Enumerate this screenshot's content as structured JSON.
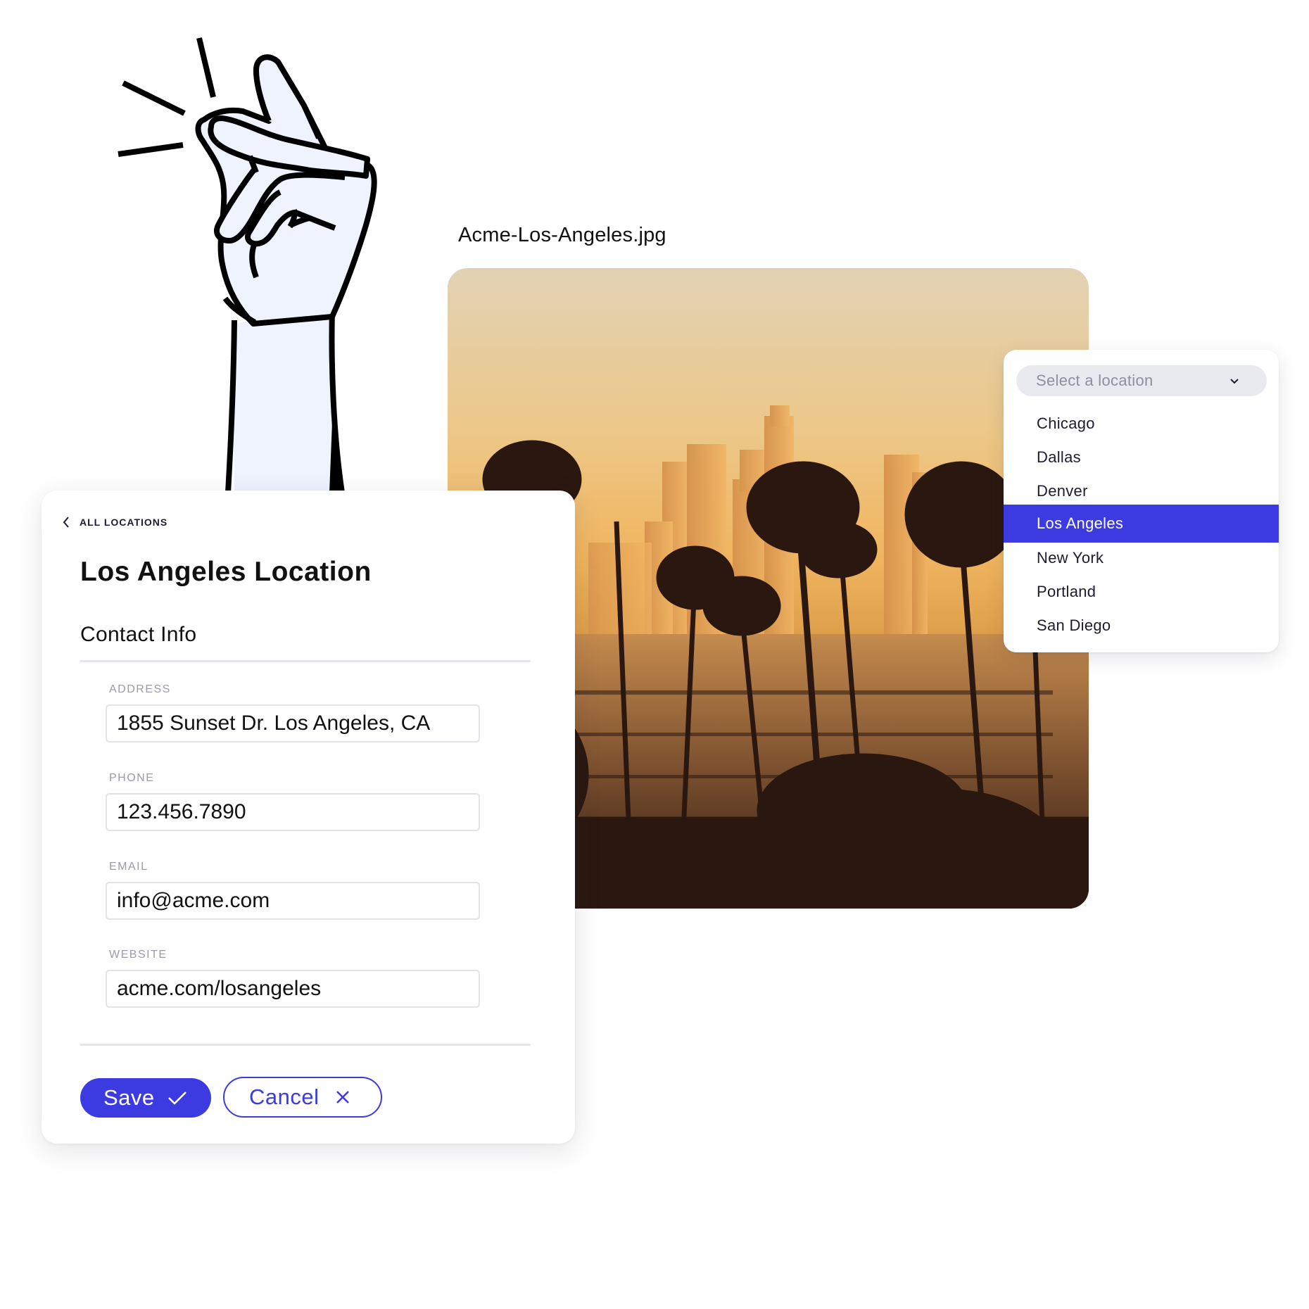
{
  "image_card": {
    "filename": "Acme-Los-Angeles.jpg",
    "photo_alt": "Los Angeles skyline at sunset with palm trees"
  },
  "location_dropdown": {
    "placeholder": "Select a location",
    "chevron_icon": "chevron-down-icon",
    "options": [
      {
        "label": "Chicago",
        "selected": false
      },
      {
        "label": "Dallas",
        "selected": false
      },
      {
        "label": "Denver",
        "selected": false
      },
      {
        "label": "Los Angeles",
        "selected": true
      },
      {
        "label": "New York",
        "selected": false
      },
      {
        "label": "Portland",
        "selected": false
      },
      {
        "label": "San Diego",
        "selected": false
      }
    ],
    "selected_color": "#3c3ae1"
  },
  "location_card": {
    "back_link": {
      "label": "ALL LOCATIONS",
      "icon": "chevron-left-icon"
    },
    "title": "Los Angeles Location",
    "section_title": "Contact Info",
    "fields": {
      "address": {
        "label": "ADDRESS",
        "value": "1855 Sunset Dr. Los Angeles, CA"
      },
      "phone": {
        "label": "PHONE",
        "value": "123.456.7890"
      },
      "email": {
        "label": "EMAIL",
        "value": "info@acme.com"
      },
      "website": {
        "label": "WEBSITE",
        "value": "acme.com/losangeles"
      }
    },
    "actions": {
      "save_label": "Save",
      "save_icon": "check-icon",
      "cancel_label": "Cancel",
      "cancel_icon": "close-icon"
    }
  },
  "illustration": {
    "name": "finger-snap-hand",
    "fill_color": "#eef3fe",
    "stroke_color": "#000000"
  },
  "colors": {
    "accent": "#3c3ae1",
    "text_primary": "#111111",
    "label_muted": "#9a9aa8",
    "input_border": "#e3e3ea"
  }
}
